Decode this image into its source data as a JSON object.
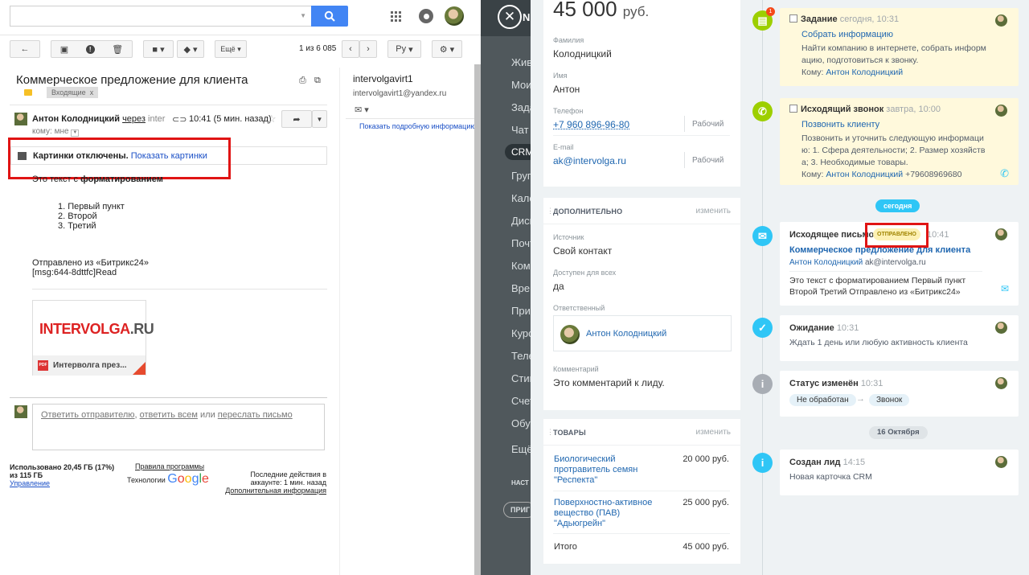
{
  "gmail": {
    "toolbar": {
      "back_icon": "back-arrow-icon",
      "more_label": "Ещё",
      "pager": "1 из 6 085",
      "lang": "Ру"
    },
    "subject": "Коммерческое предложение для клиента",
    "label": "Входящие",
    "label_close": "x",
    "sender_name": "Антон Колодницкий",
    "sender_via": "через",
    "sender_rest": "inter",
    "time": "10:41 (5 мин. назад)",
    "to": "кому: мне",
    "images_off": "Картинки отключены.",
    "show_images": "Показать картинки",
    "body_intro": "Это текст с ",
    "body_bold": "форматированием",
    "list": [
      "1. Первый пункт",
      "2. Второй",
      "3. Третий"
    ],
    "sent_from": "Отправлено из «Битрикс24»",
    "msg_id": "[msg:644-8dttfc]Read",
    "attachment_logo_a": "INTERVOLGA",
    "attachment_logo_b": ".RU",
    "attachment_name": "Интерволга през...",
    "reply_sender": "Ответить отправителю",
    "reply_all": "ответить всем",
    "reply_or": "или",
    "forward": "переслать письмо",
    "storage": "Использовано 20,45 ГБ (17%)",
    "storage_of": "из 115 ГБ",
    "manage": "Управление",
    "rules": "Правила программы",
    "tech": "Технологии",
    "google": "Google",
    "last_activity_1": "Последние действия в",
    "last_activity_2": "аккаунте: 1 мин. назад",
    "details": "Дополнительная информация",
    "contact_name": "intervolgavirt1",
    "contact_email": "intervolgavirt1@yandex.ru",
    "contact_more": "Показать подробную информацию"
  },
  "bitrix": {
    "nav": [
      "Жив",
      "Мои",
      "Зада",
      "Чат",
      "CRM",
      "Груп",
      "Кале",
      "Диск",
      "Почт",
      "Комп",
      "Врем",
      "Прил",
      "Курс",
      "Теле",
      "Стик",
      "Счет",
      "Обуч",
      "Ещё",
      "НАСТ",
      "ПРИГ"
    ]
  },
  "card": {
    "amount": "45 000",
    "currency": "руб.",
    "fields": [
      {
        "label": "Фамилия",
        "value": "Колодницкий"
      },
      {
        "label": "Имя",
        "value": "Антон"
      },
      {
        "label": "Телефон",
        "value": "+7 960 896-96-80",
        "tag": "Рабочий"
      },
      {
        "label": "E-mail",
        "value": "ak@intervolga.ru",
        "tag": "Рабочий"
      }
    ],
    "extra_title": "ДОПОЛНИТЕЛЬНО",
    "edit": "изменить",
    "source_label": "Источник",
    "source_value": "Свой контакт",
    "access_label": "Доступен для всех",
    "access_value": "да",
    "resp_label": "Ответственный",
    "resp_value": "Антон Колодницкий",
    "comment_label": "Комментарий",
    "comment_value": "Это комментарий к лиду.",
    "goods_title": "ТОВАРЫ",
    "goods": [
      {
        "name1": "Биологический",
        "name2": "протравитель семян",
        "name3": "\"Респекта\"",
        "price": "20 000 руб."
      },
      {
        "name1": "Поверхностно-активное",
        "name2": "вещество (ПАВ)",
        "name3": "\"Адьюгрейн\"",
        "price": "25 000 руб."
      }
    ],
    "total_label": "Итого",
    "total_value": "45 000 руб."
  },
  "timeline": {
    "task_title": "Задание",
    "task_time": "сегодня, 10:31",
    "task_link": "Собрать информацию",
    "task_text": [
      "Найти компанию в интернете, собрать информ",
      "ацию, подготовиться к звонку."
    ],
    "task_to_label": "Кому:",
    "task_to": "Антон Колодницкий",
    "badge": "1",
    "call_title": "Исходящий звонок",
    "call_time": "завтра, 10:00",
    "call_link": "Позвонить клиенту",
    "call_text": [
      "Позвонить и уточнить следующую информаци",
      "ю: 1. Сфера деятельности; 2. Размер хозяйств",
      "а; 3. Необходимые товары."
    ],
    "call_to_label": "Кому:",
    "call_to": "Антон Колодницкий",
    "call_phone": "+79608969680",
    "today": "сегодня",
    "mail_title": "Исходящее письмо",
    "mail_status": "ОТПРАВЛЕНО",
    "mail_time": "10:41",
    "mail_subject": "Коммерческое предложение для клиента",
    "mail_from": "Антон Колодницкий",
    "mail_addr": "ak@intervolga.ru",
    "mail_text": [
      "Это текст с форматированием Первый пункт",
      "Второй Третий Отправлено из «Битрикс24»"
    ],
    "wait_title": "Ожидание",
    "wait_time": "10:31",
    "wait_text": "Ждать 1 день или любую активность клиента",
    "status_title": "Статус изменён",
    "status_time": "10:31",
    "status_from": "Не обработан",
    "status_arrow": "→",
    "status_to": "Звонок",
    "date_pill": "16 Октября",
    "created_title": "Создан лид",
    "created_time": "14:15",
    "created_text": "Новая карточка CRM"
  }
}
